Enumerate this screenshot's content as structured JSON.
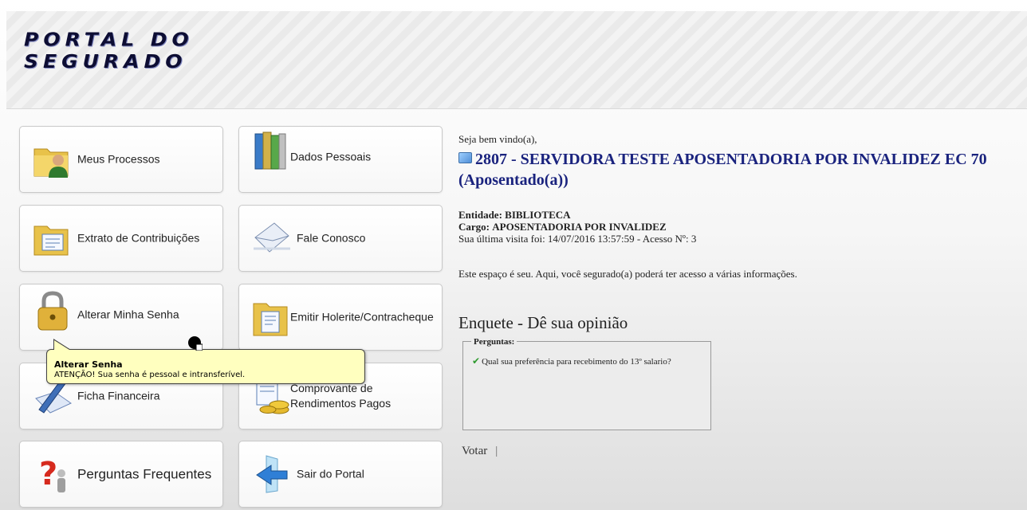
{
  "header": {
    "logo_line1": "PORTAL DO",
    "logo_line2": "SEGURADO"
  },
  "menu": [
    {
      "label": "Meus Processos",
      "icon": "folder-user-icon"
    },
    {
      "label": "Dados Pessoais",
      "icon": "binders-icon"
    },
    {
      "label": "Extrato de Contribuições",
      "icon": "folder-document-icon"
    },
    {
      "label": "Fale Conosco",
      "icon": "envelope-icon"
    },
    {
      "label": "Alterar Minha Senha",
      "icon": "padlock-icon"
    },
    {
      "label": "Emitir Holerite/Contracheque",
      "icon": "folder-document-icon"
    },
    {
      "label": "Ficha Financeira",
      "icon": "pen-paper-icon"
    },
    {
      "label": "Comprovante de Rendimentos Pagos",
      "icon": "coins-icon"
    },
    {
      "label": "Perguntas Frequentes",
      "icon": "question-mark-icon"
    },
    {
      "label": "Sair do Portal",
      "icon": "exit-arrow-icon"
    }
  ],
  "user": {
    "welcome": "Seja bem vindo(a),",
    "name_line1": "2807 - SERVIDORA TESTE APOSENTADORIA POR INVALIDEZ EC 70",
    "name_line2": "(Aposentado(a))",
    "entidade_label": "Entidade:",
    "entidade": "BIBLIOTECA",
    "cargo_label": "Cargo:",
    "cargo": "APOSENTADORIA POR INVALIDEZ",
    "last_visit": "Sua última visita foi: 14/07/2016 13:57:59 - Acesso Nº: 3",
    "description": "Este espaço é seu. Aqui, você segurado(a) poderá ter acesso a várias informações."
  },
  "poll": {
    "title": "Enquete - Dê sua opinião",
    "legend": "Perguntas:",
    "question": "Qual sua preferência para recebimento do 13º salario?",
    "vote_label": "Votar",
    "separator": "|"
  },
  "tooltip": {
    "title": "Alterar Senha",
    "text": "ATENÇÃO! Sua senha é pessoal e intransferível."
  },
  "colors": {
    "name": "#1a237e",
    "tooltip_bg": "#ffffbf",
    "logo": "#0d0d33"
  }
}
